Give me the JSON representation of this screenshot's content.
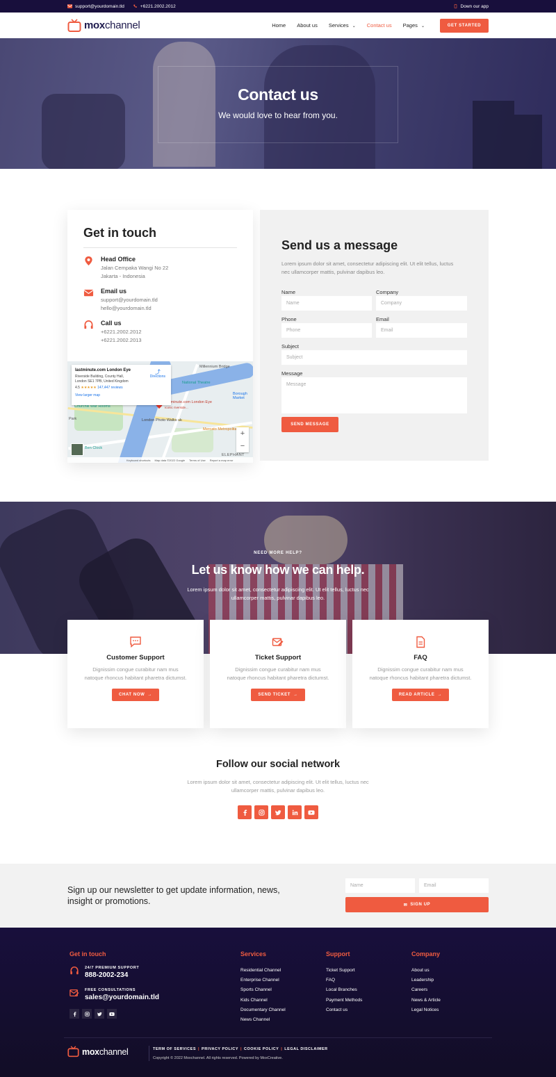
{
  "topbar": {
    "email": "support@yourdomain.tld",
    "phone": "+6221.2002.2012",
    "app_link": "Down our app"
  },
  "brand": {
    "name_bold": "mox",
    "name_regular": "channel"
  },
  "nav": {
    "items": [
      "Home",
      "About us",
      "Services",
      "Contact us",
      "Pages"
    ],
    "active": "Contact us",
    "cta": "GET STARTED"
  },
  "hero": {
    "title": "Contact us",
    "subtitle": "We would love to hear from you."
  },
  "get_in_touch": {
    "title": "Get in touch",
    "office": {
      "title": "Head Office",
      "lines": [
        "Jalan Cempaka Wangi No 22",
        "Jakarta - Indonesia"
      ]
    },
    "email": {
      "title": "Email us",
      "lines": [
        "support@yourdomain.tld",
        "hello@yourdomain.tld"
      ]
    },
    "call": {
      "title": "Call us",
      "lines": [
        "+6221.2002.2012",
        "+6221.2002.2013"
      ]
    }
  },
  "map": {
    "place": "lastminute.com London Eye",
    "address": [
      "Riverside Building, County Hall,",
      "London SE1 7PB, United Kingdom"
    ],
    "rating": "4.5",
    "stars": "★★★★★",
    "reviews": "147,447 reviews",
    "view_larger": "View larger map",
    "directions": "Directions",
    "labels": {
      "national_theatre": "National Theatre",
      "millennium": "Millennium Bridge",
      "churchill": "Churchill War Rooms",
      "walks": "London Photo Walks uk",
      "eye": "lastminute.com London Eye",
      "eye_sub": "Iconic riverside...",
      "mercato": "Mercato Metropolitano",
      "borough": "Borough Market",
      "big_ben": "Ben Clock",
      "park": "Park",
      "elephant": "ELEPHANT"
    },
    "footer": [
      "Keyboard shortcuts",
      "Map data ©2022 Google",
      "Terms of Use",
      "Report a map error"
    ]
  },
  "message_form": {
    "title": "Send us a message",
    "intro": "Lorem ipsum dolor sit amet, consectetur adipiscing elit. Ut elit tellus, luctus nec ullamcorper mattis, pulvinar dapibus leo.",
    "fields": {
      "name": {
        "label": "Name",
        "placeholder": "Name"
      },
      "company": {
        "label": "Company",
        "placeholder": "Company"
      },
      "phone": {
        "label": "Phone",
        "placeholder": "Phone"
      },
      "email": {
        "label": "Email",
        "placeholder": "Email"
      },
      "subject": {
        "label": "Subject",
        "placeholder": "Subject"
      },
      "message": {
        "label": "Message",
        "placeholder": "Message"
      }
    },
    "submit": "SEND MESSAGE"
  },
  "help": {
    "eyebrow": "NEED MORE HELP?",
    "title": "Let us know how we can help.",
    "description": "Lorem ipsum dolor sit amet, consectetur adipiscing elit. Ut elit tellus, luctus nec ullamcorper mattis, pulvinar dapibus leo.",
    "cards": [
      {
        "title": "Customer Support",
        "text": "Dignissim congue curabitur nam mus natoque rhoncus habitant pharetra dictumst.",
        "button": "CHAT NOW"
      },
      {
        "title": "Ticket Support",
        "text": "Dignissim congue curabitur nam mus natoque rhoncus habitant pharetra dictumst.",
        "button": "SEND TICKET"
      },
      {
        "title": "FAQ",
        "text": "Dignissim congue curabitur nam mus natoque rhoncus habitant pharetra dictumst.",
        "button": "READ ARTICLE"
      }
    ]
  },
  "social": {
    "title": "Follow our social network",
    "description": "Lorem ipsum dolor sit amet, consectetur adipiscing elit. Ut elit tellus, luctus nec ullamcorper mattis, pulvinar dapibus leo.",
    "icons": [
      "facebook-icon",
      "instagram-icon",
      "twitter-icon",
      "linkedin-icon",
      "youtube-icon"
    ]
  },
  "newsletter": {
    "text": "Sign up our newsletter to get update information, news, insight or promotions.",
    "name_placeholder": "Name",
    "email_placeholder": "Email",
    "button": "SIGN UP"
  },
  "footer": {
    "contact": {
      "title": "Get in touch",
      "support_label": "24/7 PREMIUM SUPPORT",
      "support_value": "888-2002-234",
      "consult_label": "FREE CONSULTATIONS",
      "consult_value": "sales@yourdomain.tld"
    },
    "services": {
      "title": "Services",
      "items": [
        "Residential Channel",
        "Enterprise Channel",
        "Sports Channel",
        "Kids Channel",
        "Documentary Channel",
        "News Channel"
      ]
    },
    "support": {
      "title": "Support",
      "items": [
        "Ticket Support",
        "FAQ",
        "Local Branches",
        "Payment Methods",
        "Contact us"
      ]
    },
    "company": {
      "title": "Company",
      "items": [
        "About us",
        "Leadership",
        "Careers",
        "News & Article",
        "Legal Notices"
      ]
    },
    "legal": [
      "TERM OF SERVICES",
      "PRIVACY POLICY",
      "COOKIE POLICY",
      "LEGAL DISCLAIMER"
    ],
    "copyright": "Copyright © 2022 Moxchannel. All rights reserved. Powered by MoxCreative."
  },
  "colors": {
    "accent": "#ef5b40",
    "navy": "#180f3c",
    "card_bg": "#f1f1f1"
  }
}
